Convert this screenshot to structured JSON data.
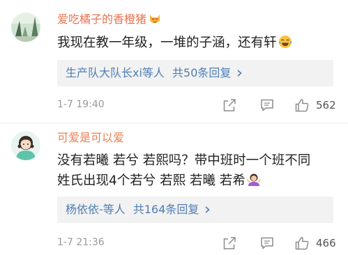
{
  "comments": [
    {
      "username": "爱吃橘子的香橙猪",
      "username_emoji": "heart-eyes-cat-emoji",
      "lines": [
        "我现在教一年级，一堆的子涵，还有轩"
      ],
      "end_emoji": "tears-of-joy-emoji",
      "replies": {
        "names": "生产队大队长xi等人",
        "count_text": "共50条回复"
      },
      "time": "1-7 19:40",
      "likes": "562"
    },
    {
      "username": "可爱是可以爱",
      "lines": [
        "没有若曦 若兮 若熙吗？带中班时一个班不同",
        "姓氏出现4个若兮 若熙 若曦 若希"
      ],
      "end_emoji": "person-shrugging-emoji",
      "replies": {
        "names": "杨依依-等人",
        "count_text": "共164条回复"
      },
      "time": "1-7 21:36",
      "likes": "466"
    }
  ],
  "colors": {
    "username": "#eb7350",
    "link": "#4f7db3",
    "meta": "#9a9a9a",
    "reply_bg": "#f2f2f2"
  },
  "icons": [
    "share-icon",
    "comment-icon",
    "thumbs-up-icon",
    "chevron-right-icon"
  ]
}
